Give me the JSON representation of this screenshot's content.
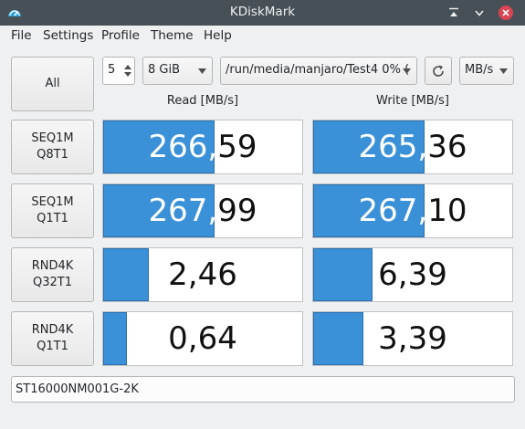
{
  "window": {
    "title": "KDiskMark",
    "icon": "speedometer-icon"
  },
  "menu": [
    "File",
    "Settings",
    "Profile",
    "Theme",
    "Help"
  ],
  "toolbar": {
    "all_label": "All",
    "loops_value": "5",
    "size_value": "8 GiB",
    "path_value": "/run/media/manjaro/Test4 0% (",
    "refresh_icon": "refresh-icon",
    "unit_value": "MB/s"
  },
  "headers": {
    "read": "Read [MB/s]",
    "write": "Write [MB/s]"
  },
  "tests": [
    {
      "line1": "SEQ1M",
      "line2": "Q8T1",
      "read_value": "266,59",
      "read_fraction": 0.56,
      "write_value": "265,36",
      "write_fraction": 0.56
    },
    {
      "line1": "SEQ1M",
      "line2": "Q1T1",
      "read_value": "267,99",
      "read_fraction": 0.56,
      "write_value": "267,10",
      "write_fraction": 0.56
    },
    {
      "line1": "RND4K",
      "line2": "Q32T1",
      "read_value": "2,46",
      "read_fraction": 0.23,
      "write_value": "6,39",
      "write_fraction": 0.3
    },
    {
      "line1": "RND4K",
      "line2": "Q1T1",
      "read_value": "0,64",
      "read_fraction": 0.12,
      "write_value": "3,39",
      "write_fraction": 0.25
    }
  ],
  "drive_info": "ST16000NM001G-2K",
  "colors": {
    "bar_fill": "#3b91d8",
    "titlebar": "#475057",
    "close_button": "#da4453"
  }
}
